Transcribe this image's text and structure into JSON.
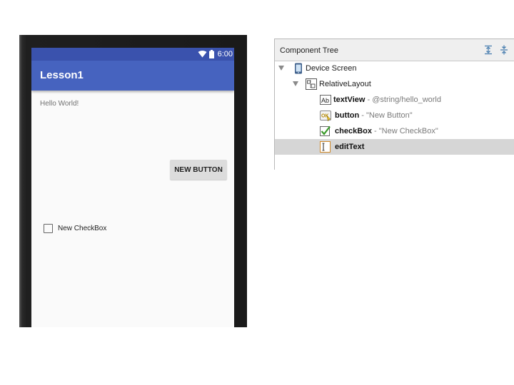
{
  "phone": {
    "status_time": "6:00",
    "app_title": "Lesson1",
    "hello_text": "Hello World!",
    "button_label": "NEW BUTTON",
    "checkbox_label": "New CheckBox",
    "colors": {
      "status_bar": "#3a52ad",
      "app_bar": "#4663bf",
      "screen_bg": "#fafafa"
    }
  },
  "component_tree": {
    "title": "Component Tree",
    "header_icons": [
      "expand-all-icon",
      "collapse-all-icon"
    ],
    "nodes": [
      {
        "name": "Device Screen",
        "icon": "device-screen-icon"
      },
      {
        "name": "RelativeLayout",
        "icon": "relative-layout-icon"
      },
      {
        "name": "textView",
        "detail": "- @string/hello_world",
        "icon": "text-view-icon"
      },
      {
        "name": "button",
        "detail": "- \"New Button\"",
        "icon": "button-widget-icon"
      },
      {
        "name": "checkBox",
        "detail": "- \"New CheckBox\"",
        "icon": "checkbox-widget-icon"
      },
      {
        "name": "editText",
        "icon": "edit-text-icon",
        "selected": true
      }
    ]
  }
}
